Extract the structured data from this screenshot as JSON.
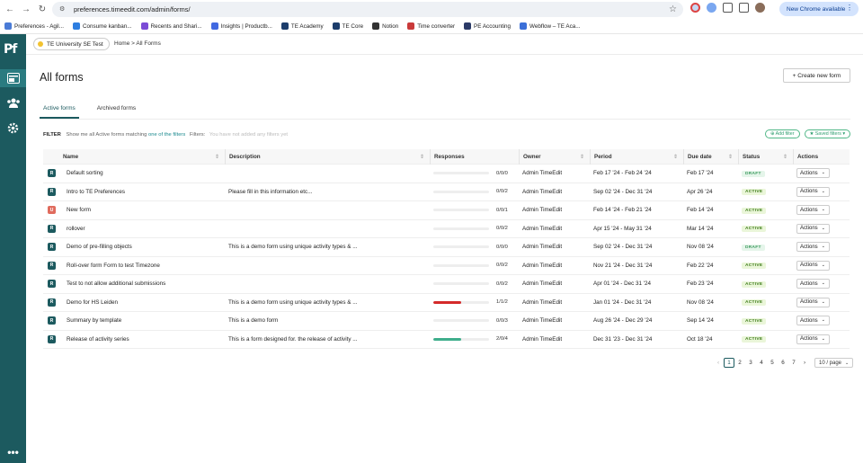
{
  "browser": {
    "url": "preferences.timeedit.com/admin/forms/",
    "new_chrome_label": "New Chrome available"
  },
  "bookmarks": [
    {
      "label": "Preferences - Agil...",
      "color": "#4a7bd6"
    },
    {
      "label": "Consume kanban...",
      "color": "#2d7ee0"
    },
    {
      "label": "Recents and Shari...",
      "color": "#7b4bd6"
    },
    {
      "label": "Insights | Productb...",
      "color": "#4169e1"
    },
    {
      "label": "TE Academy",
      "color": "#1c3d6b"
    },
    {
      "label": "TE Core",
      "color": "#1c3d6b"
    },
    {
      "label": "Notion",
      "color": "#333333"
    },
    {
      "label": "Time converter",
      "color": "#c93a3a"
    },
    {
      "label": "PE Accounting",
      "color": "#2b3a67"
    },
    {
      "label": "Webflow – TE Aca...",
      "color": "#3b6fd8"
    }
  ],
  "app": {
    "logo": "Pf",
    "tenant": "TE University SE Test",
    "breadcrumb": "Home > All Forms",
    "page_title": "All forms",
    "create_button": "+ Create new form",
    "tabs": [
      "Active forms",
      "Archived forms"
    ],
    "filter": {
      "label": "FILTER",
      "text": "Show me all Active forms matching",
      "link": "one of the filters",
      "filters_label": "Filters:",
      "no_filters": "You have not added any filters yet",
      "add_filter": "⊕ Add filter",
      "saved_filters": "★ Saved filters ▾"
    }
  },
  "table": {
    "columns": [
      "Name",
      "Description",
      "Responses",
      "Owner",
      "Period",
      "Due date",
      "Status",
      "Actions"
    ],
    "rows": [
      {
        "badge": "R",
        "badge_color": "teal",
        "name": "Default sorting",
        "description": "",
        "progress": 0,
        "progress_color": "#eeeeee",
        "responses": "0/0/0",
        "owner": "Admin TimeEdit",
        "period": "Feb 17 '24 - Feb 24 '24",
        "due": "Feb 17 '24",
        "status": "DRAFT",
        "action": "Actions"
      },
      {
        "badge": "R",
        "badge_color": "teal",
        "name": "Intro to TE Preferences",
        "description": "Please fill in this information etc...",
        "progress": 0,
        "progress_color": "#eeeeee",
        "responses": "0/0/2",
        "owner": "Admin TimeEdit",
        "period": "Sep 02 '24 - Dec 31 '24",
        "due": "Apr 26 '24",
        "status": "ACTIVE",
        "action": "Actions"
      },
      {
        "badge": "U",
        "badge_color": "red",
        "name": "New form",
        "description": "",
        "progress": 0,
        "progress_color": "#eeeeee",
        "responses": "0/0/1",
        "owner": "Admin TimeEdit",
        "period": "Feb 14 '24 - Feb 21 '24",
        "due": "Feb 14 '24",
        "status": "ACTIVE",
        "action": "Actions"
      },
      {
        "badge": "R",
        "badge_color": "teal",
        "name": "rollover",
        "description": "",
        "progress": 0,
        "progress_color": "#eeeeee",
        "responses": "0/0/2",
        "owner": "Admin TimeEdit",
        "period": "Apr 15 '24 - May 31 '24",
        "due": "Mar 14 '24",
        "status": "ACTIVE",
        "action": "Actions"
      },
      {
        "badge": "R",
        "badge_color": "teal",
        "name": "Demo of pre-filling objects",
        "description": "This is a demo form using unique activity types & ...",
        "progress": 0,
        "progress_color": "#eeeeee",
        "responses": "0/0/0",
        "owner": "Admin TimeEdit",
        "period": "Sep 02 '24 - Dec 31 '24",
        "due": "Nov 08 '24",
        "status": "DRAFT",
        "action": "Actions"
      },
      {
        "badge": "R",
        "badge_color": "teal",
        "name": "Roll-over form Form to test Timezone",
        "description": "",
        "progress": 0,
        "progress_color": "#eeeeee",
        "responses": "0/0/2",
        "owner": "Admin TimeEdit",
        "period": "Nov 21 '24 - Dec 31 '24",
        "due": "Feb 22 '24",
        "status": "ACTIVE",
        "action": "Actions"
      },
      {
        "badge": "R",
        "badge_color": "teal",
        "name": "Test to not allow additional submissions",
        "description": "",
        "progress": 0,
        "progress_color": "#eeeeee",
        "responses": "0/0/2",
        "owner": "Admin TimeEdit",
        "period": "Apr 01 '24 - Dec 31 '24",
        "due": "Feb 23 '24",
        "status": "ACTIVE",
        "action": "Actions"
      },
      {
        "badge": "R",
        "badge_color": "teal",
        "name": "Demo for HS Leiden",
        "description": "This is a demo form using unique activity types & ...",
        "progress": 0.5,
        "progress_color": "#d42a2a",
        "responses": "1/1/2",
        "owner": "Admin TimeEdit",
        "period": "Jan 01 '24 - Dec 31 '24",
        "due": "Nov 08 '24",
        "status": "ACTIVE",
        "action": "Actions"
      },
      {
        "badge": "R",
        "badge_color": "teal",
        "name": "Summary by template",
        "description": "This is a demo form",
        "progress": 0,
        "progress_color": "#eeeeee",
        "responses": "0/0/3",
        "owner": "Admin TimeEdit",
        "period": "Aug 26 '24 - Dec 29 '24",
        "due": "Sep 14 '24",
        "status": "ACTIVE",
        "action": "Actions"
      },
      {
        "badge": "R",
        "badge_color": "teal",
        "name": "Release of activity series",
        "description": "This is a form designed for. the release of activity ...",
        "progress": 0.5,
        "progress_color": "#3fae8c",
        "responses": "2/0/4",
        "owner": "Admin TimeEdit",
        "period": "Dec 31 '23 - Dec 31 '24",
        "due": "Oct 18 '24",
        "status": "ACTIVE",
        "action": "Actions"
      }
    ]
  },
  "pagination": {
    "pages": [
      "1",
      "2",
      "3",
      "4",
      "5",
      "6",
      "7"
    ],
    "current": "1",
    "per_page": "10 / page"
  }
}
